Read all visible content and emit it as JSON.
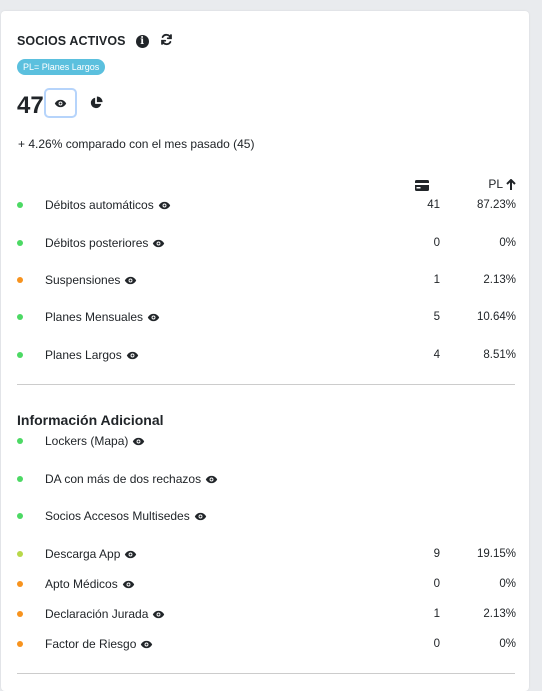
{
  "header": {
    "title": "SOCIOS ACTIVOS",
    "info_icon": "info-circle-icon",
    "refresh_icon": "sync-icon"
  },
  "badge": "PL= Planes Largos",
  "total": "47",
  "comparison": "+ 4.26% comparado con el mes pasado (45)",
  "columns": {
    "card_icon": "credit-card-icon",
    "pl_label": "PL",
    "sort_icon": "arrow-up-icon"
  },
  "rows": [
    {
      "label": "Débitos automáticos",
      "count": "41",
      "pct": "87.23%",
      "color": "#4cd964"
    },
    {
      "label": "Débitos posteriores",
      "count": "0",
      "pct": "0%",
      "color": "#4cd964"
    },
    {
      "label": "Suspensiones",
      "count": "1",
      "pct": "2.13%",
      "color": "#f7931e"
    },
    {
      "label": "Planes Mensuales",
      "count": "5",
      "pct": "10.64%",
      "color": "#4cd964"
    },
    {
      "label": "Planes Largos",
      "count": "4",
      "pct": "8.51%",
      "color": "#4cd964"
    }
  ],
  "additional": {
    "title": "Información Adicional",
    "rows": [
      {
        "label": "Lockers (Mapa)",
        "count": "",
        "pct": "",
        "color": "#4cd964"
      },
      {
        "label": "DA con más de dos rechazos",
        "count": "",
        "pct": "",
        "color": "#4cd964"
      },
      {
        "label": "Socios Accesos Multisedes",
        "count": "",
        "pct": "",
        "color": "#4cd964"
      },
      {
        "label": "Descarga App",
        "count": "9",
        "pct": "19.15%",
        "color": "#b8d84a"
      },
      {
        "label": "Apto Médicos",
        "count": "0",
        "pct": "0%",
        "color": "#f7931e"
      },
      {
        "label": "Declaración Jurada",
        "count": "1",
        "pct": "2.13%",
        "color": "#f7931e"
      },
      {
        "label": "Factor de Riesgo",
        "count": "0",
        "pct": "0%",
        "color": "#f7931e"
      }
    ]
  }
}
